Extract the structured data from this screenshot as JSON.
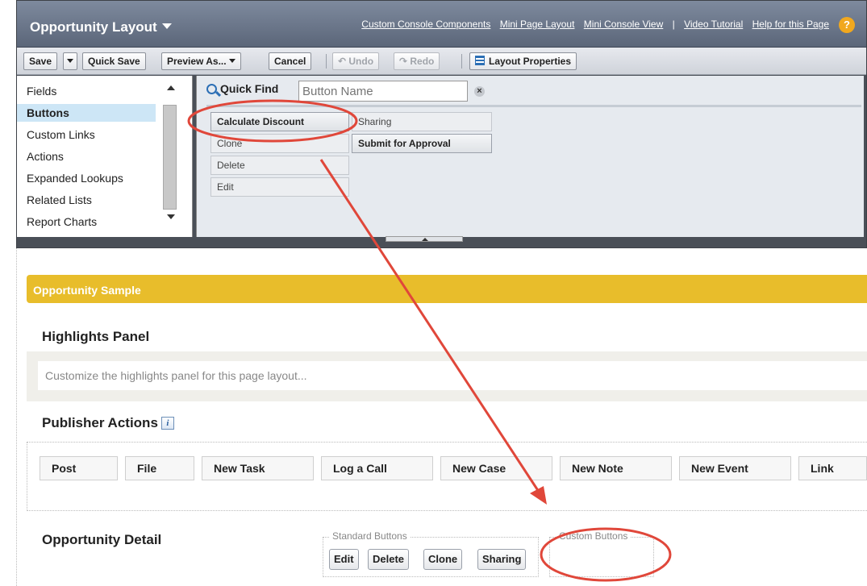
{
  "header": {
    "title": "Opportunity Layout",
    "links": [
      "Custom Console Components",
      "Mini Page Layout",
      "Mini Console View",
      "Video Tutorial",
      "Help for this Page"
    ],
    "separator": "|",
    "help_icon_glyph": "?"
  },
  "toolbar": {
    "save": "Save",
    "quick_save": "Quick Save",
    "preview_as": "Preview As...",
    "cancel": "Cancel",
    "undo": "Undo",
    "redo": "Redo",
    "layout_properties": "Layout Properties"
  },
  "palette": {
    "categories": [
      "Fields",
      "Buttons",
      "Custom Links",
      "Actions",
      "Expanded Lookups",
      "Related Lists",
      "Report Charts"
    ],
    "selected_category": "Buttons",
    "quick_find_label": "Quick Find",
    "quick_find_placeholder": "Button Name",
    "buttons_col1": [
      "Calculate Discount",
      "Clone",
      "Delete",
      "Edit"
    ],
    "buttons_col2": [
      "Sharing",
      "Submit for Approval"
    ]
  },
  "canvas": {
    "section_title": "Opportunity Sample",
    "highlights_heading": "Highlights Panel",
    "highlights_placeholder": "Customize the highlights panel for this page layout...",
    "publisher_heading": "Publisher Actions",
    "publisher_actions": [
      "Post",
      "File",
      "New Task",
      "Log a Call",
      "New Case",
      "New Note",
      "New Event",
      "Link"
    ],
    "detail_heading": "Opportunity Detail",
    "standard_buttons_legend": "Standard Buttons",
    "standard_buttons": [
      "Edit",
      "Delete",
      "Clone",
      "Sharing"
    ],
    "custom_buttons_legend": "Custom Buttons"
  },
  "colors": {
    "annotation": "#e0473a",
    "section_bar": "#e8bd2b",
    "selected_category": "#cde6f6"
  }
}
